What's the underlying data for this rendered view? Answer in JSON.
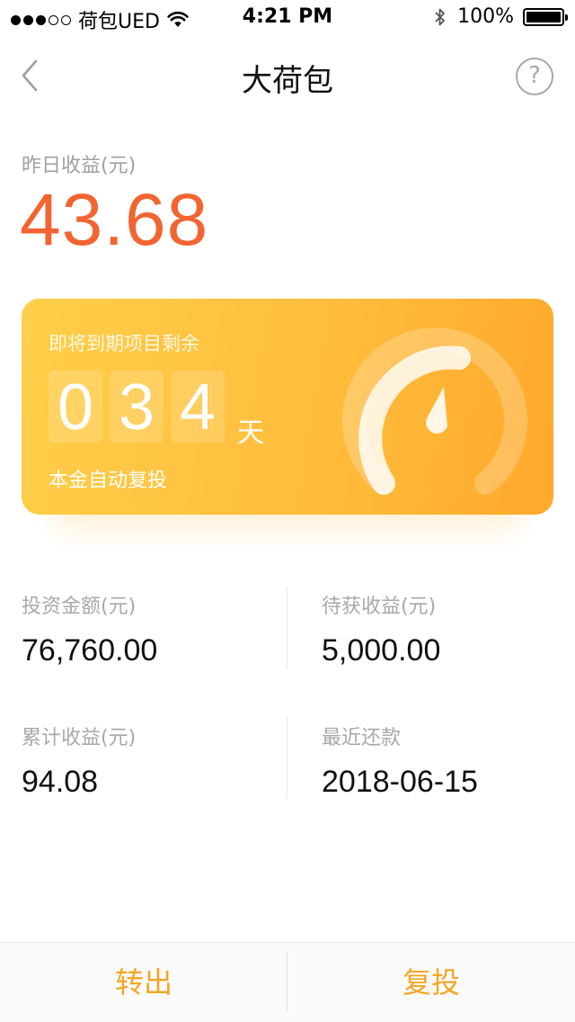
{
  "status_bar": {
    "carrier": "荷包UED",
    "time": "4:21 PM",
    "battery": "100%",
    "battery_level": 1.0,
    "signal_bars_filled": 3,
    "signal_bars_total": 5
  },
  "nav": {
    "title": "大荷包",
    "help_label": "?"
  },
  "earnings": {
    "label": "昨日收益(元)",
    "value": "43.68",
    "color": "#f26531"
  },
  "card": {
    "label": "即将到期项目剩余",
    "digits": [
      "0",
      "3",
      "4"
    ],
    "unit": "天",
    "note": "本金自动复投"
  },
  "stats": {
    "invest_amount": {
      "label": "投资金额(元)",
      "value": "76,760.00"
    },
    "pending_income": {
      "label": "待获收益(元)",
      "value": "5,000.00"
    },
    "total_income": {
      "label": "累计收益(元)",
      "value": "94.08"
    },
    "recent_repay": {
      "label": "最近还款",
      "value": "2018-06-15"
    }
  },
  "bottom": {
    "transfer_out": "转出",
    "reinvest": "复投"
  },
  "colors": {
    "accent": "#f5a623",
    "card_start": "#ffcf4a",
    "card_end": "#ffa92c"
  }
}
